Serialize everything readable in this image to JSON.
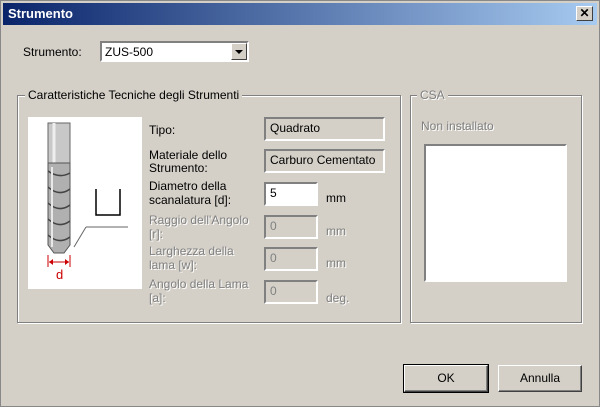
{
  "window": {
    "title": "Strumento",
    "close_symbol": "✕"
  },
  "tool": {
    "label": "Strumento:",
    "selected": "ZUS-500"
  },
  "specs": {
    "group_title": "Caratteristiche Tecniche degli Strumenti",
    "diagram_label": "d",
    "tipo_label": "Tipo:",
    "tipo_value": "Quadrato",
    "materiale_label_1": "Materiale dello",
    "materiale_label_2": "Strumento:",
    "materiale_value": "Carburo Cementato",
    "diametro_label_1": "Diametro della",
    "diametro_label_2": "scanalatura [d]:",
    "diametro_value": "5",
    "diametro_unit": "mm",
    "raggio_label_1": "Raggio dell'Angolo",
    "raggio_label_2": "[r]:",
    "raggio_value": "0",
    "raggio_unit": "mm",
    "larghezza_label_1": "Larghezza della",
    "larghezza_label_2": "lama [w]:",
    "larghezza_value": "0",
    "larghezza_unit": "mm",
    "angolo_label_1": "Angolo della Lama",
    "angolo_label_2": "[a]:",
    "angolo_value": "0",
    "angolo_unit": "deg."
  },
  "csa": {
    "group_title": "CSA",
    "status": "Non installato"
  },
  "buttons": {
    "ok": "OK",
    "cancel": "Annulla"
  }
}
